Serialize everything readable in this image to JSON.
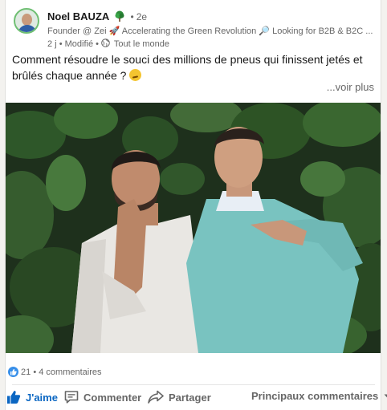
{
  "post": {
    "author": {
      "name": "Noel BAUZA",
      "badge_icon": "tree-icon",
      "separator": "•",
      "degree": "2e",
      "headline": "Founder @ Zei 🚀 Accelerating the Green Revolution 🔎 Looking for B2B & B2C ...",
      "time": "2 j",
      "edited": "Modifié",
      "visibility": "Tout le monde"
    },
    "text": "Comment résoudre le souci des millions de pneus qui finissent jetés et brûlés chaque année ?",
    "see_more": "...voir plus"
  },
  "social": {
    "reactions_count": "21",
    "comments": "4 commentaires",
    "separator": "•"
  },
  "actions": {
    "like": "J'aime",
    "comment": "Commenter",
    "share": "Partager",
    "sort": "Principaux commentaires"
  },
  "colors": {
    "accent": "#0a66c2",
    "reaction_blue": "#378fe9"
  }
}
